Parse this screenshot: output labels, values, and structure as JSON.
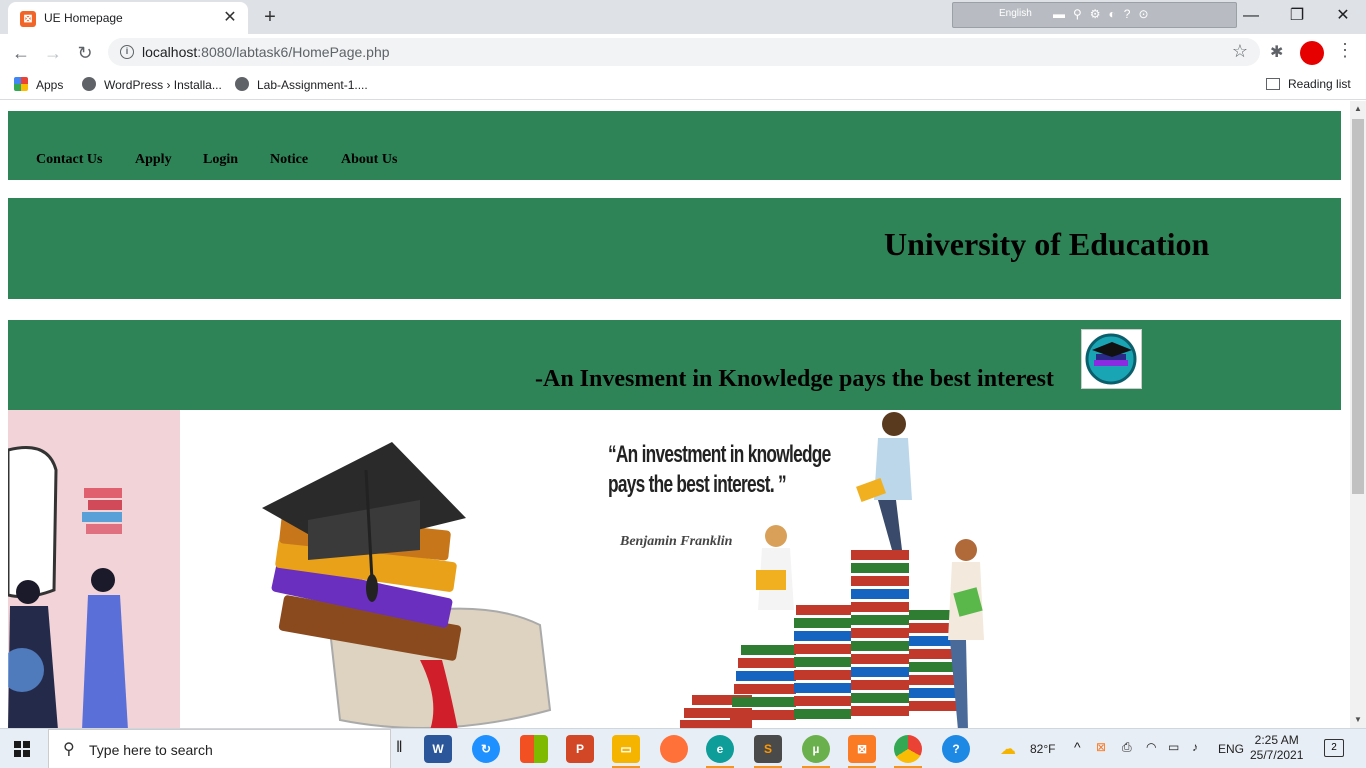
{
  "browser": {
    "tab_title": "UE Homepage",
    "tab_close": "✕",
    "new_tab": "+",
    "language_bar_text": "English",
    "url_host": "localhost",
    "url_rest": ":8080/labtask6/HomePage.php",
    "bookmarks": [
      {
        "label": "Apps",
        "icon": "apps-icon"
      },
      {
        "label": "WordPress › Installa...",
        "icon": "globe-icon"
      },
      {
        "label": "Lab-Assignment-1....",
        "icon": "globe-icon"
      }
    ],
    "reading_list": "Reading list",
    "window_controls": {
      "minimize": "—",
      "restore": "❐",
      "close": "✕"
    }
  },
  "page": {
    "nav": [
      "Contact Us",
      "Apply",
      "Login",
      "Notice",
      "About Us"
    ],
    "title": "University of Education",
    "motto": "-An Invesment in Knowledge pays the best interest",
    "quote_line1": "“An investment in knowledge",
    "quote_line2": "pays the best interest. ”",
    "quote_author": "Benjamin Franklin",
    "theme_color": "#2e8457"
  },
  "taskbar": {
    "search_placeholder": "Type here to search",
    "apps": [
      "word-icon",
      "refresh-app-icon",
      "office-icon",
      "powerpoint-icon",
      "file-explorer-icon",
      "firefox-icon",
      "edge-icon",
      "sublime-icon",
      "utorrent-icon",
      "xampp-icon",
      "chrome-icon",
      "help-icon"
    ],
    "weather": "82°F",
    "language": "ENG",
    "time": "2:25 AM",
    "date": "25/7/2021",
    "notifications": "2"
  }
}
